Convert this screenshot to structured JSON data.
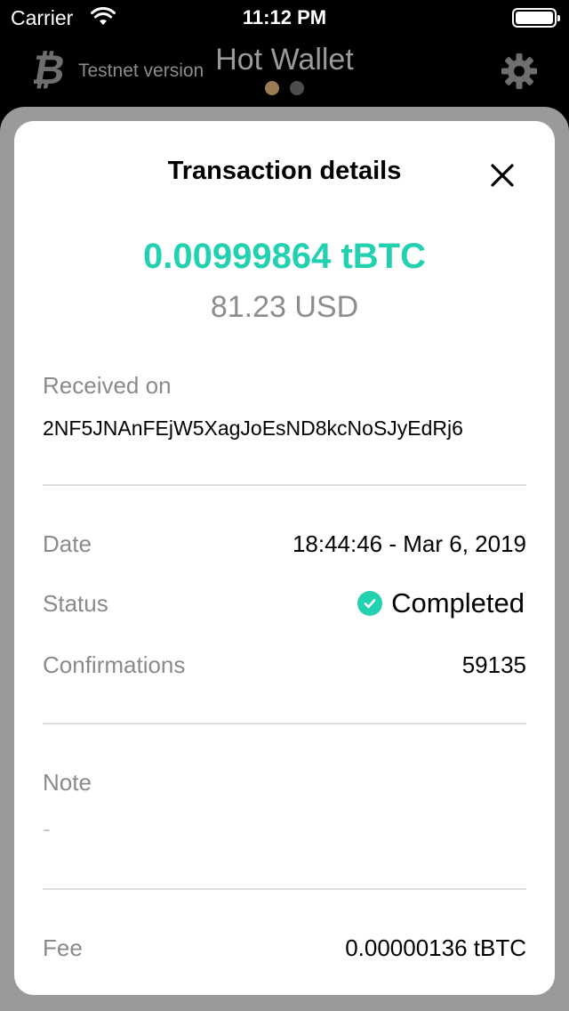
{
  "status_bar": {
    "carrier": "Carrier",
    "time": "11:12 PM"
  },
  "header": {
    "testnet_label": "Testnet version",
    "title": "Hot Wallet",
    "page_dots": {
      "count": 2,
      "active_index": 0
    }
  },
  "transaction": {
    "title": "Transaction details",
    "amount": "0.00999864 tBTC",
    "fiat_amount": "81.23 USD",
    "received_on_label": "Received on",
    "address": "2NF5JNAnFEjW5XagJoEsND8kcNoSJyEdRj6",
    "date_label": "Date",
    "date_value": "18:44:46 - Mar 6, 2019",
    "status_label": "Status",
    "status_value": "Completed",
    "confirmations_label": "Confirmations",
    "confirmations_value": "59135",
    "note_label": "Note",
    "note_value": "-",
    "fee_label": "Fee",
    "fee_value": "0.00000136 tBTC"
  },
  "colors": {
    "accent": "#22d1b0",
    "label_gray": "#8a8a8a",
    "divider": "#dedede",
    "active_dot": "#9a7b55"
  },
  "icons": [
    "wifi-icon",
    "battery-icon",
    "bitcoin-logo-icon",
    "gear-icon",
    "close-icon",
    "check-circle-icon"
  ]
}
